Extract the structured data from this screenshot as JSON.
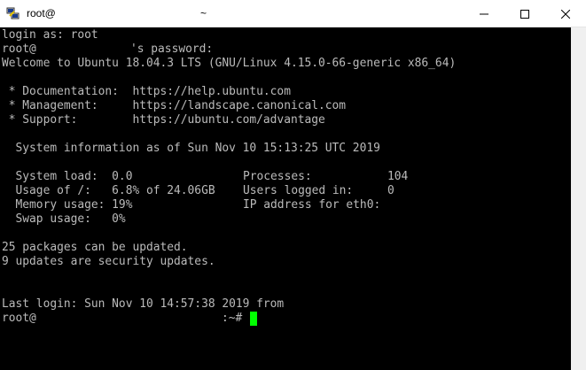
{
  "window": {
    "title_left": "root@",
    "title_center": "~",
    "minimize_glyph": "—",
    "close_glyph": "✕"
  },
  "terminal": {
    "login_line": "login as: root",
    "password_user": "root@",
    "password_prompt": "'s password:",
    "welcome": "Welcome to Ubuntu 18.04.3 LTS (GNU/Linux 4.15.0-66-generic x86_64)",
    "links": [
      " * Documentation:  https://help.ubuntu.com",
      " * Management:     https://landscape.canonical.com",
      " * Support:        https://ubuntu.com/advantage"
    ],
    "sysinfo_header": "  System information as of Sun Nov 10 15:13:25 UTC 2019",
    "stats_left": [
      "  System load:  0.0",
      "  Usage of /:   6.8% of 24.06GB",
      "  Memory usage: 19%",
      "  Swap usage:   0%"
    ],
    "stats_right": [
      "Processes:           104",
      "Users logged in:     0",
      "IP address for eth0:"
    ],
    "updates": [
      "25 packages can be updated.",
      "9 updates are security updates."
    ],
    "last_login": "Last login: Sun Nov 10 14:57:38 2019 from",
    "prompt_user": "root@",
    "prompt_suffix": ":~#"
  },
  "colors": {
    "background": "#000000",
    "foreground": "#bbbbbb",
    "cursor": "#00ff00"
  }
}
